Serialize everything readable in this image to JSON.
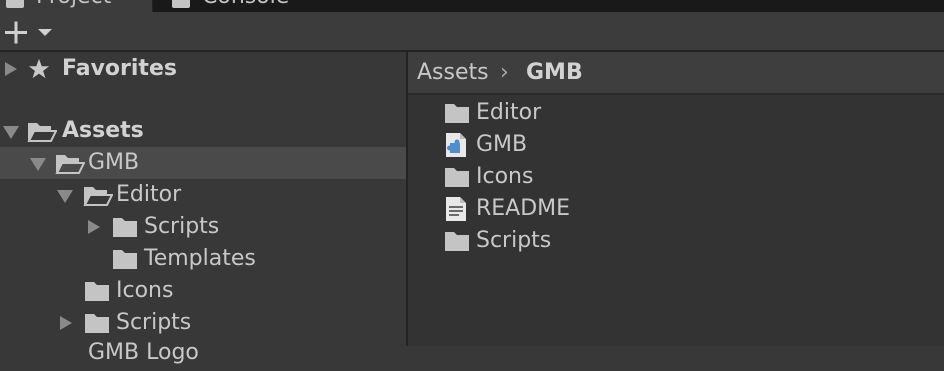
{
  "tabs": [
    {
      "label": "Project"
    },
    {
      "label": "Console"
    }
  ],
  "toolbar": {
    "add_label": "+"
  },
  "tree": {
    "favorites": {
      "label": "Favorites",
      "icon": "star-icon"
    },
    "assets": {
      "label": "Assets"
    },
    "items": [
      {
        "label": "GMB",
        "selected": true
      },
      {
        "label": "Editor"
      },
      {
        "label": "Scripts"
      },
      {
        "label": "Templates"
      },
      {
        "label": "Icons"
      },
      {
        "label": "Scripts"
      },
      {
        "label": "GMB Logo"
      }
    ]
  },
  "breadcrumb": {
    "root": "Assets",
    "separator": "›",
    "current": "GMB"
  },
  "content": {
    "items": [
      {
        "label": "Editor",
        "icon": "folder-icon"
      },
      {
        "label": "GMB",
        "icon": "assembly-definition-icon"
      },
      {
        "label": "Icons",
        "icon": "folder-icon"
      },
      {
        "label": "README",
        "icon": "text-document-icon"
      },
      {
        "label": "Scripts",
        "icon": "folder-icon"
      }
    ]
  },
  "colors": {
    "background": "#383838",
    "selection": "#4a4a4a",
    "text": "#c8c8c8",
    "folder": "#c4c4c4",
    "asmdef_accent": "#4f8fcf"
  }
}
